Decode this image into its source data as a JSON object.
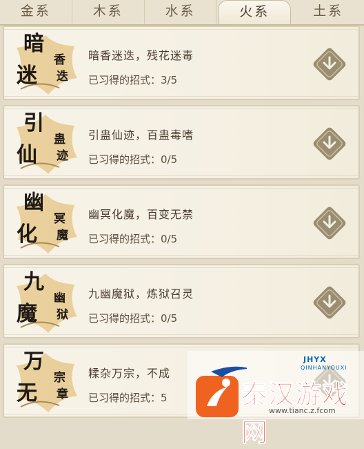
{
  "tabs": [
    {
      "label": "金系"
    },
    {
      "label": "木系"
    },
    {
      "label": "水系"
    },
    {
      "label": "火系"
    },
    {
      "label": "土系"
    }
  ],
  "active_tab": "火系",
  "skills": [
    {
      "glyphs": [
        "暗",
        "迷",
        "香",
        "迭"
      ],
      "title": "暗香迷迭，残花迷毒",
      "progress": "已习得的招式：3/5"
    },
    {
      "glyphs": [
        "引",
        "仙",
        "蛊",
        "迹"
      ],
      "title": "引蛊仙迹，百蛊毒嗜",
      "progress": "已习得的招式：0/5"
    },
    {
      "glyphs": [
        "幽",
        "化",
        "冥",
        "魔"
      ],
      "title": "幽冥化魔，百变无禁",
      "progress": "已习得的招式：0/5"
    },
    {
      "glyphs": [
        "九",
        "魔",
        "幽",
        "狱"
      ],
      "title": "九幽魔狱，炼狱召灵",
      "progress": "已习得的招式：0/5"
    },
    {
      "glyphs": [
        "万",
        "无",
        "宗",
        "章"
      ],
      "title": "糅杂万宗，不成",
      "progress": "已习得的招式：5"
    }
  ],
  "watermark": {
    "brand": "JHYX",
    "sub": "QINHANYOUXI",
    "name": "秦汉游戏网",
    "url": "www.tianc.z.fcom"
  },
  "colors": {
    "ink": "#1f1a16",
    "text": "#4b3d2e",
    "gold_emblem": "#e6c98e",
    "button": "#9a8d70"
  },
  "icons": {
    "expand": "chevron-down-icon",
    "emblem": "cloud-emblem-icon"
  }
}
